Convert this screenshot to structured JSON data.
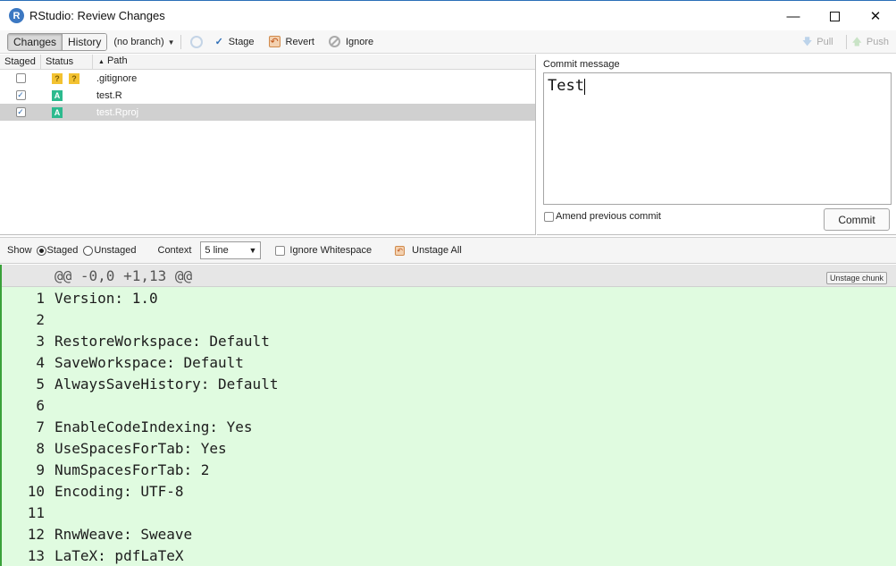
{
  "window": {
    "title": "RStudio: Review Changes",
    "logo_letter": "R"
  },
  "toolbar": {
    "tabs": [
      "Changes",
      "History"
    ],
    "branch": "(no branch)",
    "stage_label": "Stage",
    "revert_label": "Revert",
    "ignore_label": "Ignore",
    "pull_label": "Pull",
    "push_label": "Push"
  },
  "file_list": {
    "headers": {
      "staged": "Staged",
      "status": "Status",
      "path": "Path"
    },
    "rows": [
      {
        "staged": false,
        "status": [
          "?",
          "?"
        ],
        "path": ".gitignore"
      },
      {
        "staged": true,
        "status": [
          "A"
        ],
        "path": "test.R"
      },
      {
        "staged": true,
        "status": [
          "A"
        ],
        "path": "test.Rproj",
        "selected": true
      }
    ]
  },
  "commit": {
    "label": "Commit message",
    "message": "Test",
    "amend_label": "Amend previous commit",
    "commit_button": "Commit"
  },
  "options": {
    "show_label": "Show",
    "staged_label": "Staged",
    "unstaged_label": "Unstaged",
    "context_label": "Context",
    "context_value": "5 line",
    "ignore_ws_label": "Ignore Whitespace",
    "unstage_all_label": "Unstage All"
  },
  "diff": {
    "hunk_header": "@@ -0,0 +1,13 @@",
    "unstage_chunk": "Unstage chunk",
    "lines": [
      {
        "num": "1",
        "text": "Version: 1.0"
      },
      {
        "num": "2",
        "text": ""
      },
      {
        "num": "3",
        "text": "RestoreWorkspace: Default"
      },
      {
        "num": "4",
        "text": "SaveWorkspace: Default"
      },
      {
        "num": "5",
        "text": "AlwaysSaveHistory: Default"
      },
      {
        "num": "6",
        "text": ""
      },
      {
        "num": "7",
        "text": "EnableCodeIndexing: Yes"
      },
      {
        "num": "8",
        "text": "UseSpacesForTab: Yes"
      },
      {
        "num": "9",
        "text": "NumSpacesForTab: 2"
      },
      {
        "num": "10",
        "text": "Encoding: UTF-8"
      },
      {
        "num": "11",
        "text": ""
      },
      {
        "num": "12",
        "text": "RnwWeave: Sweave"
      },
      {
        "num": "13",
        "text": "LaTeX: pdfLaTeX"
      }
    ]
  },
  "colors": {
    "added_bg": "#e0fbe0",
    "added_border": "#3aa13a",
    "selected_row": "#d0d0d0",
    "accent": "#2f6fb7"
  }
}
